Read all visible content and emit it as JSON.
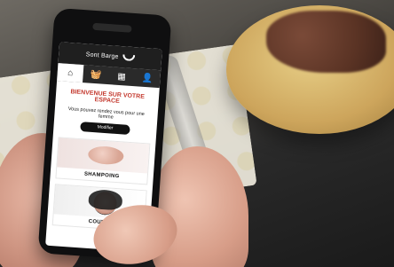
{
  "app": {
    "brand": "Sont Barge",
    "tabs": [
      {
        "icon": "home-icon",
        "glyph": "⌂"
      },
      {
        "icon": "basket-icon",
        "glyph": "🧺"
      },
      {
        "icon": "calendar-icon",
        "glyph": "▦"
      },
      {
        "icon": "user-icon",
        "glyph": "👤"
      }
    ],
    "welcome": "BIENVENUE SUR VOTRE ESPACE",
    "question": "Vous pouvez rendez vous pour une femme",
    "modify_button": "Modifier",
    "services": [
      {
        "label": "SHAMPOING",
        "image": "hand"
      },
      {
        "label": "COUPE",
        "image": "face"
      }
    ]
  }
}
